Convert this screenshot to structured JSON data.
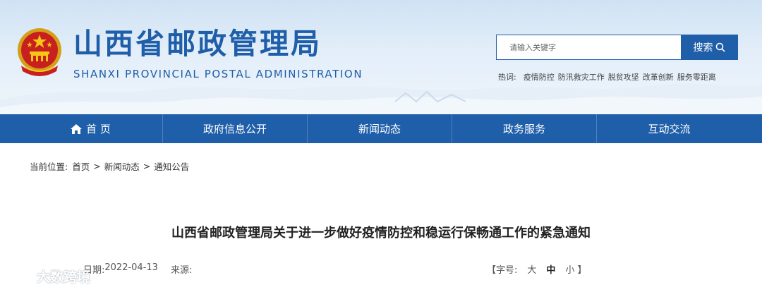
{
  "header": {
    "title": "山西省邮政管理局",
    "subtitle": "SHANXI PROVINCIAL POSTAL ADMINISTRATION",
    "emblem_icon": "national-emblem-icon"
  },
  "search": {
    "placeholder": "请输入关键字",
    "button_label": "搜索"
  },
  "hotwords": {
    "label": "热词:",
    "items": [
      "疫情防控",
      "防汛救灾工作",
      "脱贫攻坚",
      "改革创新",
      "服务零距离"
    ]
  },
  "nav": {
    "items": [
      {
        "label": "首 页",
        "icon": "home-icon"
      },
      {
        "label": "政府信息公开"
      },
      {
        "label": "新闻动态"
      },
      {
        "label": "政务服务"
      },
      {
        "label": "互动交流"
      }
    ]
  },
  "breadcrumb": {
    "label": "当前位置:",
    "items": [
      "首页",
      "新闻动态",
      "通知公告"
    ],
    "separator": ">"
  },
  "article": {
    "title": "山西省邮政管理局关于进一步做好疫情防控和稳运行保畅通工作的紧急通知",
    "date_label": "日期:",
    "date": "2022-04-13",
    "source_label": "来源:",
    "source": ""
  },
  "font_size": {
    "label": "【字号:",
    "large": "大",
    "medium": "中",
    "small": "小",
    "close": "】"
  },
  "watermark": {
    "text": "大数跨境"
  },
  "colors": {
    "brand_blue": "#1f5ea8",
    "header_bg": "#dbe9f7"
  }
}
